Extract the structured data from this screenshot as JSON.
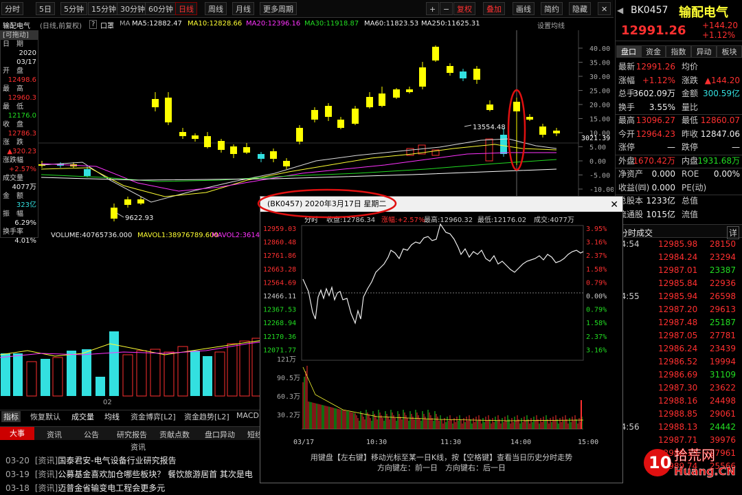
{
  "toolbar": {
    "periods": [
      "分时",
      "5日",
      "5分钟",
      "15分钟",
      "30分钟",
      "60分钟",
      "日线",
      "周线",
      "月线",
      "更多周期"
    ],
    "active": "日线",
    "actions": [
      "复权",
      "叠加",
      "画线",
      "简约",
      "隐藏"
    ]
  },
  "chart_title": {
    "name": "输配电气",
    "mode": "(日线,前复权)",
    "help": "?",
    "label": "口罩",
    "ma5": "MA5:12882.47",
    "ma10": "MA10:12828.66",
    "ma20": "MA20:12396.16",
    "ma30": "MA30:11918.87",
    "ma60": "MA60:11823.53",
    "ma250": "MA250:11625.31",
    "setting": "设置均线"
  },
  "yaxis": [
    "40.00",
    "35.00",
    "30.00",
    "25.00",
    "20.00",
    "15.00",
    "10.00",
    "5.00",
    "0.00",
    "-5.00",
    "-10.00",
    "-15.00"
  ],
  "price_marker": "3021.39",
  "annotations": {
    "high": "13554.48",
    "low": "9622.93"
  },
  "sidebox": {
    "movable": "[可拖动]",
    "date_label": "日　期",
    "year": "2020",
    "date": "03/17",
    "open_label": "开　盘",
    "open": "12498.6",
    "high_label": "最　高",
    "high": "12960.3",
    "low_label": "最　低",
    "low": "12176.0",
    "close_label": "收　盘",
    "close": "12786.3",
    "chg_label": "涨　跌",
    "chg": "▲320.23",
    "pct_label": "涨跌幅",
    "pct": "+2.57%",
    "vol_label": "成交量",
    "vol": "4077万",
    "amt_label": "金　额",
    "amt": "323亿",
    "amp_label": "振　幅",
    "amp": "6.29%",
    "turn_label": "换手率",
    "turn": "4.01%"
  },
  "volbar": {
    "vol": "VOLUME:40765736.000",
    "mavol1": "MAVOL1:38976789.600",
    "mavol2": "MAVOL2:361498893"
  },
  "vol_tick": "02",
  "bottomtabs": [
    "指标",
    "恢复默认",
    "成交量",
    "均线",
    "资金博弈[L2]",
    "资金趋势[L2]",
    "MACD"
  ],
  "newstabs": [
    "大事",
    "资讯",
    "公告",
    "研究报告",
    "贡献点数",
    "盘口异动",
    "短线"
  ],
  "news": [
    {
      "date": "03-20",
      "tag": "[资讯]",
      "text": "国泰君安-电气设备行业研究报告"
    },
    {
      "date": "03-19",
      "tag": "[资讯]",
      "text": "公募基金喜欢加仓哪些板块？ 餐饮旅游居首 其次是电"
    },
    {
      "date": "03-18",
      "tag": "[资讯]",
      "text": "迈普金省输变电工程会更多元"
    }
  ],
  "quote": {
    "code": "BK0457",
    "name": "输配电气",
    "price": "12991.26",
    "chg": "+144.20",
    "pct": "+1.12%"
  },
  "rtabs": [
    "盘口",
    "资金",
    "指数",
    "异动",
    "板块"
  ],
  "qrows": [
    {
      "l1": "最新",
      "v1": "12991.26",
      "l2": "均价",
      "v2": ""
    },
    {
      "l1": "涨幅",
      "v1": "+1.12%",
      "l2": "涨跌",
      "v2": "▲144.20"
    },
    {
      "l1": "总手",
      "v1": "3602.09万",
      "l2": "金额",
      "v2": "300.59亿"
    },
    {
      "l1": "换手",
      "v1": "3.55%",
      "l2": "量比",
      "v2": ""
    },
    {
      "l1": "最高",
      "v1": "13096.27",
      "l2": "最低",
      "v2": "12860.07"
    },
    {
      "l1": "今开",
      "v1": "12964.23",
      "l2": "昨收",
      "v2": "12847.06"
    },
    {
      "l1": "涨停",
      "v1": "—",
      "l2": "跌停",
      "v2": "—"
    },
    {
      "l1": "外盘",
      "v1": "1670.42万",
      "l2": "内盘",
      "v2": "1931.68万"
    },
    {
      "l1": "净资产",
      "v1": "0.000",
      "l2": "ROE",
      "v2": "0.00%"
    },
    {
      "l1": "收益(㈣)",
      "v1": "0.000",
      "l2": "PE(动)",
      "v2": ""
    },
    {
      "l1": "总股本",
      "v1": "1233亿",
      "l2": "总值",
      "v2": ""
    },
    {
      "l1": "流通股",
      "v1": "1015亿",
      "l2": "流值",
      "v2": ""
    }
  ],
  "trade_title": "分时成交",
  "trade_more": "详",
  "trades": [
    {
      "t": "14:54",
      "p": "12985.98",
      "v": "28150"
    },
    {
      "t": "",
      "p": "12984.24",
      "v": "23294"
    },
    {
      "t": "",
      "p": "12987.01",
      "v": "23387"
    },
    {
      "t": "",
      "p": "12985.84",
      "v": "22936"
    },
    {
      "t": "14:55",
      "p": "12985.94",
      "v": "26598"
    },
    {
      "t": "",
      "p": "12987.20",
      "v": "29613"
    },
    {
      "t": "",
      "p": "12987.48",
      "v": "25187"
    },
    {
      "t": "",
      "p": "12987.05",
      "v": "27781"
    },
    {
      "t": "",
      "p": "12986.24",
      "v": "23439"
    },
    {
      "t": "",
      "p": "12986.52",
      "v": "19994"
    },
    {
      "t": "",
      "p": "12986.69",
      "v": "31109"
    },
    {
      "t": "",
      "p": "12987.30",
      "v": "23622"
    },
    {
      "t": "",
      "p": "12988.16",
      "v": "24498"
    },
    {
      "t": "",
      "p": "12988.85",
      "v": "29061"
    },
    {
      "t": "14:56",
      "p": "12988.13",
      "v": "24442"
    },
    {
      "t": "",
      "p": "12987.71",
      "v": "39976"
    },
    {
      "t": "",
      "p": "12986.13",
      "v": "27961"
    },
    {
      "t": "",
      "p": "12989.74",
      "v": "25566"
    }
  ],
  "popup": {
    "title": "(BK0457) 2020年3月17日 星期二",
    "fs": "分时",
    "close": "收盘:12786.34",
    "amp": "涨幅:+2.57%",
    "high": "最高:12960.32",
    "low": "最低:12176.02",
    "vol": "成交:4077万",
    "left_ticks": [
      "12959.03",
      "12860.48",
      "12761.86",
      "12663.28",
      "12564.69",
      "12466.11",
      "12367.53",
      "12268.94",
      "12170.36",
      "12071.77"
    ],
    "right_ticks": [
      "3.95%",
      "3.16%",
      "2.37%",
      "1.58%",
      "0.79%",
      "0.00%",
      "0.79%",
      "1.58%",
      "2.37%",
      "3.16%"
    ],
    "vol_ticks": [
      "121万",
      "90.5万",
      "60.3万",
      "30.2万"
    ],
    "time_ticks": [
      "03/17",
      "10:30",
      "11:30",
      "14:00",
      "15:00"
    ],
    "foot1": "用键盘【左右键】移动光标至某一日K线，按【空格键】查看当日历史分时走势",
    "foot2": "方向键左：前一日　方向键右：后一日"
  },
  "stamp": {
    "text": "10拾荒网",
    "sub": "Huang.CN"
  },
  "colors": {
    "up": "#ff3030",
    "down": "#22dd22",
    "yang": "#ffff00",
    "yin": "#33e0e0"
  }
}
